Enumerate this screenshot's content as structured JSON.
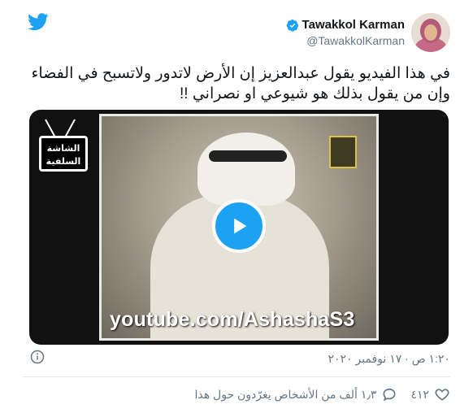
{
  "author": {
    "name": "Tawakkol Karman",
    "handle": "@TawakkolKarman",
    "verified": true
  },
  "tweet": {
    "text_line1": "في هذا الفيديو يقول عبدالعزيز إن الأرض لاتدور ولاتسبح في الفضاء",
    "text_line2": "وإن من يقول بذلك هو شيوعي او نصراني !!"
  },
  "media": {
    "watermark": "youtube.com/AshashaS3",
    "tv_label_line1": "الشاشة",
    "tv_label_line2": "السلفية"
  },
  "meta": {
    "timestamp": "١:٢٠ ص · ١٧ نوفمبر ٢٠٢٠"
  },
  "actions": {
    "likes": "٤١٢",
    "replies": "١٫٣ ألف من الأشخاص يغرّدون حول هذا"
  },
  "colors": {
    "accent": "#1da1f2",
    "text": "#14171a",
    "muted": "#657786"
  },
  "icons": {
    "brand": "twitter-bird-icon",
    "verified": "verified-badge-icon",
    "play": "play-icon",
    "info": "info-icon",
    "like": "heart-icon",
    "reply": "speech-bubble-icon"
  }
}
